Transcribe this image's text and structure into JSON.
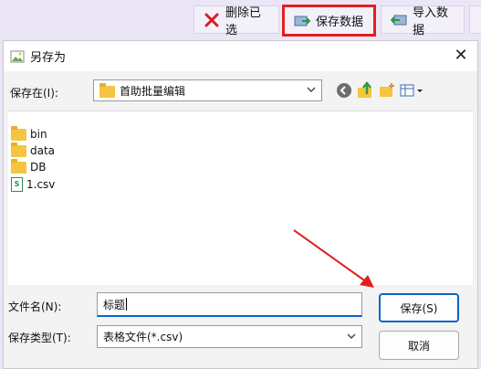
{
  "toolbar": {
    "delete_label": "删除已选",
    "save_label": "保存数据",
    "import_label": "导入数据"
  },
  "dialog": {
    "title": "另存为",
    "close_glyph": "✕",
    "look_in_label": "保存在(I):",
    "look_in_value": "首助批量编辑",
    "files": [
      {
        "name": "bin",
        "type": "folder"
      },
      {
        "name": "data",
        "type": "folder"
      },
      {
        "name": "DB",
        "type": "folder"
      },
      {
        "name": "1.csv",
        "type": "csv"
      }
    ],
    "filename_label": "文件名(N):",
    "filename_value": "标题",
    "filetype_label": "保存类型(T):",
    "filetype_value": "表格文件(*.csv)",
    "save_button": "保存(S)",
    "cancel_button": "取消"
  },
  "colors": {
    "highlight_border": "#e02020",
    "annotation_arrow": "#e02020",
    "focus_accent": "#0a64c8"
  },
  "icons": {
    "delete": "red-x-icon",
    "save": "save-data-icon",
    "import": "import-data-icon",
    "back": "back-icon",
    "up": "up-folder-icon",
    "new_folder": "new-folder-icon",
    "view": "view-menu-icon"
  }
}
